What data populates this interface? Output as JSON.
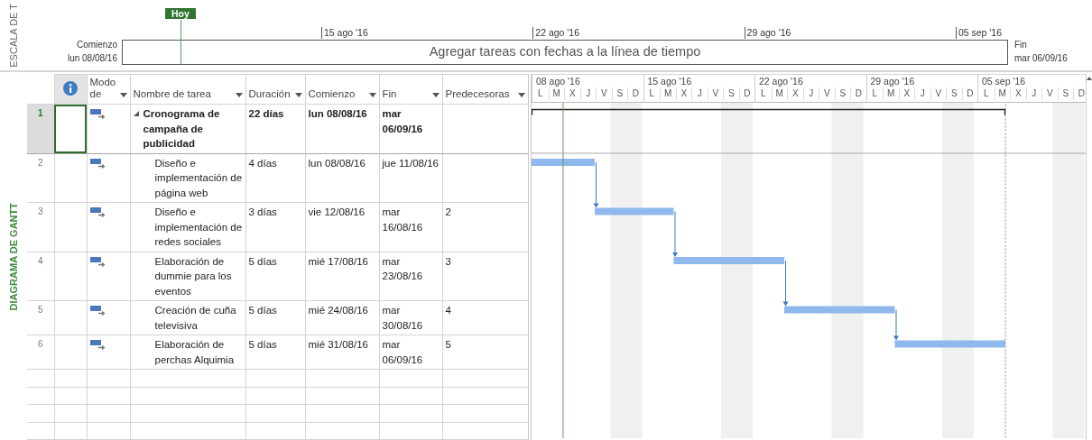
{
  "timeline": {
    "side_label": "ESCALA DE T",
    "today": "Hoy",
    "start_label": "Comienzo",
    "start_date": "lun 08/08/16",
    "end_label": "Fin",
    "end_date": "mar 06/09/16",
    "placeholder": "Agregar tareas con fechas a la línea de tiempo",
    "ticks": [
      "15 ago '16",
      "22 ago '16",
      "29 ago '16",
      "05 sep '16"
    ]
  },
  "view_label": "DIAGRAMA DE GANTT",
  "table": {
    "columns": [
      "Modo de",
      "Nombre de tarea",
      "Duración",
      "Comienzo",
      "Fin",
      "Predecesoras"
    ],
    "rows": [
      {
        "id": "1",
        "kind": "summary",
        "selected": true,
        "expanded": true,
        "name": "Cronograma de campaña de publicidad",
        "duration": "22 días",
        "start": "lun 08/08/16",
        "finish": "mar 06/09/16"
      },
      {
        "id": "2",
        "kind": "task",
        "selected": false,
        "name": "Diseño e implementación de página web",
        "duration": "4 días",
        "start": "lun 08/08/16",
        "finish": "jue 11/08/16"
      },
      {
        "id": "3",
        "kind": "task",
        "selected": false,
        "name": "Diseño e implementación de redes sociales",
        "duration": "3 días",
        "start": "vie 12/08/16",
        "finish": "mar 16/08/16",
        "predecessors": "2"
      },
      {
        "id": "4",
        "kind": "task",
        "selected": false,
        "name": "Elaboración de dummie para los eventos",
        "duration": "5 días",
        "start": "mié 17/08/16",
        "finish": "mar 23/08/16",
        "predecessors": "3"
      },
      {
        "id": "5",
        "kind": "task",
        "selected": false,
        "name": "Creación de cuña televisiva",
        "duration": "5 días",
        "start": "mié 24/08/16",
        "finish": "mar 30/08/16",
        "predecessors": "4"
      },
      {
        "id": "6",
        "kind": "task",
        "selected": false,
        "name": "Elaboración de perchas Alquimia",
        "duration": "5 días",
        "start": "mié 31/08/16",
        "finish": "mar 06/09/16",
        "predecessors": "5"
      }
    ]
  },
  "gantt": {
    "weeks": [
      {
        "label": "08 ago '16",
        "days": [
          "L",
          "M",
          "X",
          "J",
          "V",
          "S",
          "D"
        ]
      },
      {
        "label": "15 ago '16",
        "days": [
          "L",
          "M",
          "X",
          "J",
          "V",
          "S",
          "D"
        ]
      },
      {
        "label": "22 ago '16",
        "days": [
          "L",
          "M",
          "X",
          "J",
          "V",
          "S",
          "D"
        ]
      },
      {
        "label": "29 ago '16",
        "days": [
          "L",
          "M",
          "X",
          "J",
          "V",
          "S",
          "D"
        ]
      },
      {
        "label": "05 sep '16",
        "days": [
          "L",
          "M",
          "X",
          "J",
          "V",
          "S",
          "D"
        ]
      }
    ]
  }
}
